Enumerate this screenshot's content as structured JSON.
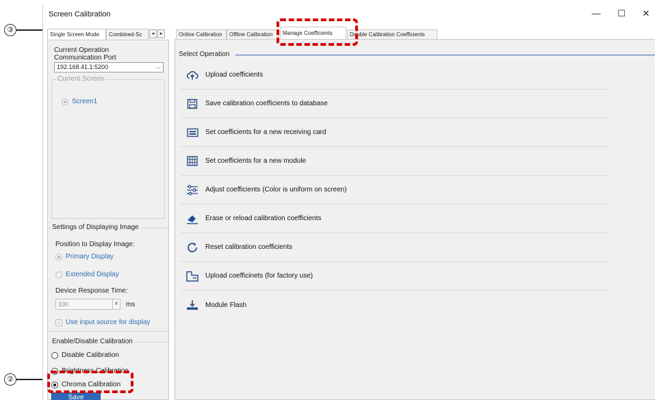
{
  "window": {
    "title": "Screen Calibration",
    "minimize": "—",
    "maximize": "☐",
    "close": "✕"
  },
  "annotations": {
    "mark3": "③",
    "mark2": "②"
  },
  "left_tabs": {
    "single": "Single Screen Mode",
    "combined": "Combined-Sc",
    "left_arrow": "◂",
    "right_arrow": "▸"
  },
  "current_operation": {
    "title": "Current Operation",
    "port_label": "Communication Port",
    "port_value": "192.168.41.1:5200"
  },
  "current_screen": {
    "title": "Current Screen",
    "screen_option": "Screen1"
  },
  "display_settings": {
    "title": "Settings of Displaying Image",
    "position_label": "Position to Display Image:",
    "primary": "Primary Display",
    "extended": "Extended Display",
    "response_label": "Device Response Time:",
    "response_value": "100",
    "response_unit": "ms",
    "use_input_source": "Use input source for display"
  },
  "enable_calibration": {
    "title": "Enable/Disable Calibration",
    "disable": "Disable Calibration",
    "brightness": "Brightness Calibration",
    "chroma": "Chroma Calibration",
    "save": "Save"
  },
  "tabs": {
    "online": "Online Calibration",
    "offline": "Offline Calibration",
    "manage": "Manage Coefficients",
    "double": "Double Calibration Coefficients"
  },
  "select_operation": "Select Operation",
  "operations": [
    {
      "label": "Upload coefficients",
      "icon": "cloud-upload-icon"
    },
    {
      "label": "Save calibration coefficients to database",
      "icon": "floppy-disk-icon"
    },
    {
      "label": "Set coefficients for a new receiving card",
      "icon": "receiving-card-icon"
    },
    {
      "label": "Set coefficients for a new module",
      "icon": "module-grid-icon"
    },
    {
      "label": "Adjust coefficients (Color is uniform on screen)",
      "icon": "sliders-icon"
    },
    {
      "label": "Erase or reload calibration coefficients",
      "icon": "eraser-icon"
    },
    {
      "label": "Reset calibration coefficients",
      "icon": "reset-icon"
    },
    {
      "label": "Upload coefficinets (for factory use)",
      "icon": "factory-icon"
    },
    {
      "label": "Module Flash",
      "icon": "flash-download-icon"
    }
  ],
  "colors": {
    "accent": "#2f67b6",
    "link_blue": "#2d6cb5",
    "annotation_red": "#d40000"
  }
}
